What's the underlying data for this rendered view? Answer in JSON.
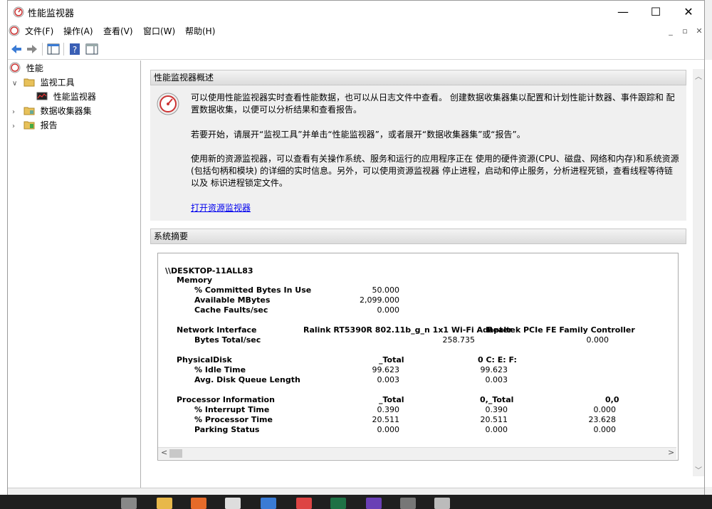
{
  "window": {
    "title": "性能监视器",
    "minimize": "—",
    "maximize": "☐",
    "close": "✕"
  },
  "menu": [
    "文件(F)",
    "操作(A)",
    "查看(V)",
    "窗口(W)",
    "帮助(H)"
  ],
  "mdi": {
    "minimize": "_",
    "restore": "▫",
    "close": "✕"
  },
  "tree": {
    "root": "性能",
    "items": [
      {
        "label": "监视工具",
        "expanded": true
      },
      {
        "label": "性能监视器"
      },
      {
        "label": "数据收集器集",
        "expanded": false
      },
      {
        "label": "报告",
        "expanded": false
      }
    ]
  },
  "overview": {
    "header": "性能监视器概述",
    "para1": "可以使用性能监视器实时查看性能数据，也可以从日志文件中查看。 创建数据收集器集以配置和计划性能计数器、事件跟踪和 配置数据收集，以便可以分析结果和查看报告。",
    "para2": "若要开始，请展开“监视工具”并单击“性能监视器”，或者展开“数据收集器集”或“报告”。",
    "para3": "使用新的资源监视器，可以查看有关操作系统、服务和运行的应用程序正在 使用的硬件资源(CPU、磁盘、网络和内存)和系统资源(包括句柄和模块) 的详细的实时信息。另外，可以使用资源监视器 停止进程，启动和停止服务，分析进程死锁，查看线程等待链以及 标识进程锁定文件。",
    "link": "打开资源监视器"
  },
  "summary": {
    "header": "系统摘要",
    "computer": "\\\\DESKTOP-11ALL83",
    "memory": {
      "label": "Memory",
      "rows": [
        {
          "name": "% Committed Bytes In Use",
          "v1": "50.000"
        },
        {
          "name": "Available MBytes",
          "v1": "2,099.000"
        },
        {
          "name": "Cache Faults/sec",
          "v1": "0.000"
        }
      ]
    },
    "network": {
      "label": "Network Interface",
      "col1": "Ralink RT5390R 802.11b_g_n 1x1 Wi-Fi Adapter",
      "col2": "Realtek PCIe FE Family Controller",
      "rows": [
        {
          "name": "Bytes Total/sec",
          "v1": "258.735",
          "v2": "0.000"
        }
      ]
    },
    "disk": {
      "label": "PhysicalDisk",
      "col1": "_Total",
      "col2": "0 C: E: F:",
      "rows": [
        {
          "name": "% Idle Time",
          "v1": "99.623",
          "v2": "99.623"
        },
        {
          "name": "Avg. Disk Queue Length",
          "v1": "0.003",
          "v2": "0.003"
        }
      ]
    },
    "processor": {
      "label": "Processor Information",
      "col1": "_Total",
      "col2": "0,_Total",
      "col3": "0,0",
      "rows": [
        {
          "name": "% Interrupt Time",
          "v1": "0.390",
          "v2": "0.390",
          "v3": "0.000"
        },
        {
          "name": "% Processor Time",
          "v1": "20.511",
          "v2": "20.511",
          "v3": "23.628"
        },
        {
          "name": "Parking Status",
          "v1": "0.000",
          "v2": "0.000",
          "v3": "0.000"
        }
      ]
    },
    "scroll_left": "<",
    "scroll_right": ">"
  },
  "colors": {
    "accent": "#0000ee",
    "taskbar": "#1f1f1f",
    "section_header": "#dcdcdc"
  },
  "taskbar_icons": [
    "task-view-icon",
    "file-explorer-icon",
    "firefox-icon",
    "mail-icon",
    "chat-icon",
    "chrome-icon",
    "excel-icon",
    "visual-studio-icon",
    "app-icon",
    "perfmon-icon"
  ]
}
